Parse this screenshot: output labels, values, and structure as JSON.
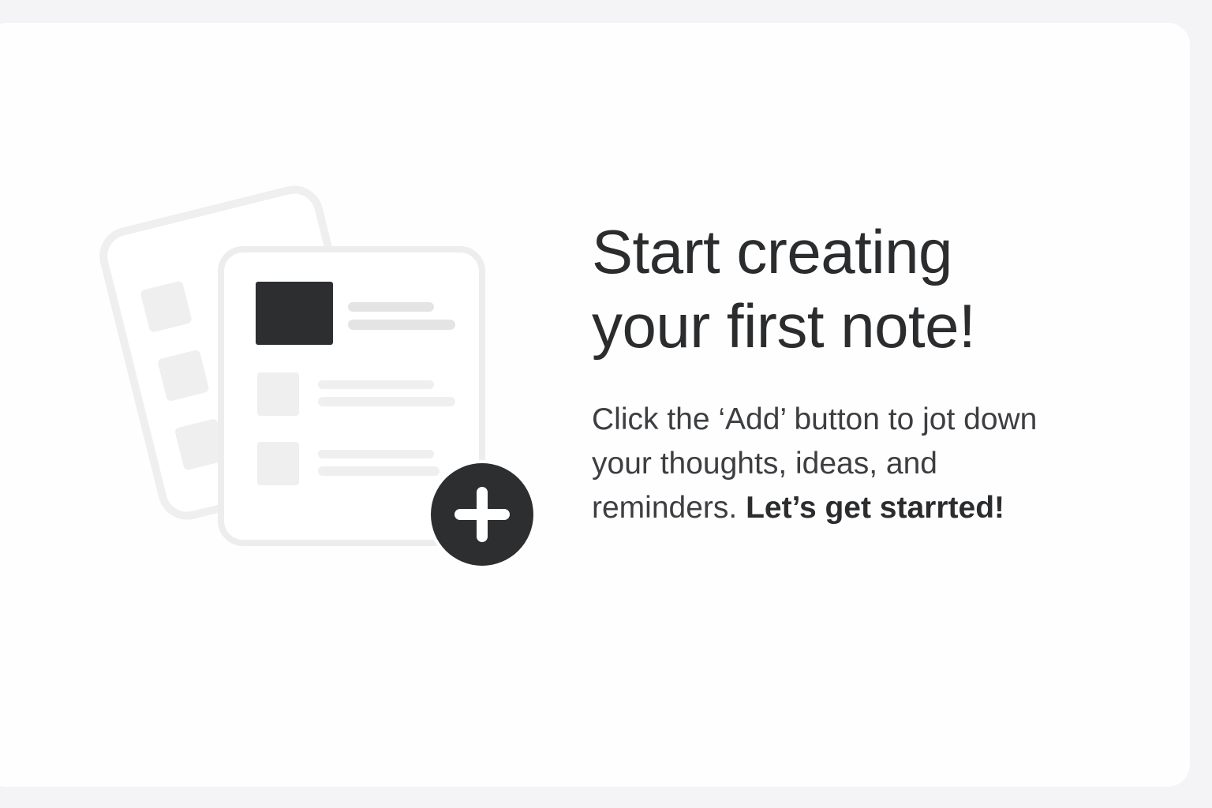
{
  "empty_state": {
    "title_line1": "Start creating",
    "title_line2": "your first note!",
    "body_line1": "Click the ‘Add’ button to jot down",
    "body_line2": "your thoughts, ideas, and",
    "body_line3_lead": "reminders. ",
    "body_line3_emphasis": "Let’s get starrted!"
  },
  "icons": {
    "illustration": "notes-stack-icon",
    "add": "plus-circle-icon"
  },
  "colors": {
    "page_background": "#f4f4f6",
    "card_background": "#fefefe",
    "primary_dark": "#2d2e30",
    "illustration_light": "#ededed",
    "text_dark": "#2b2c2e"
  }
}
